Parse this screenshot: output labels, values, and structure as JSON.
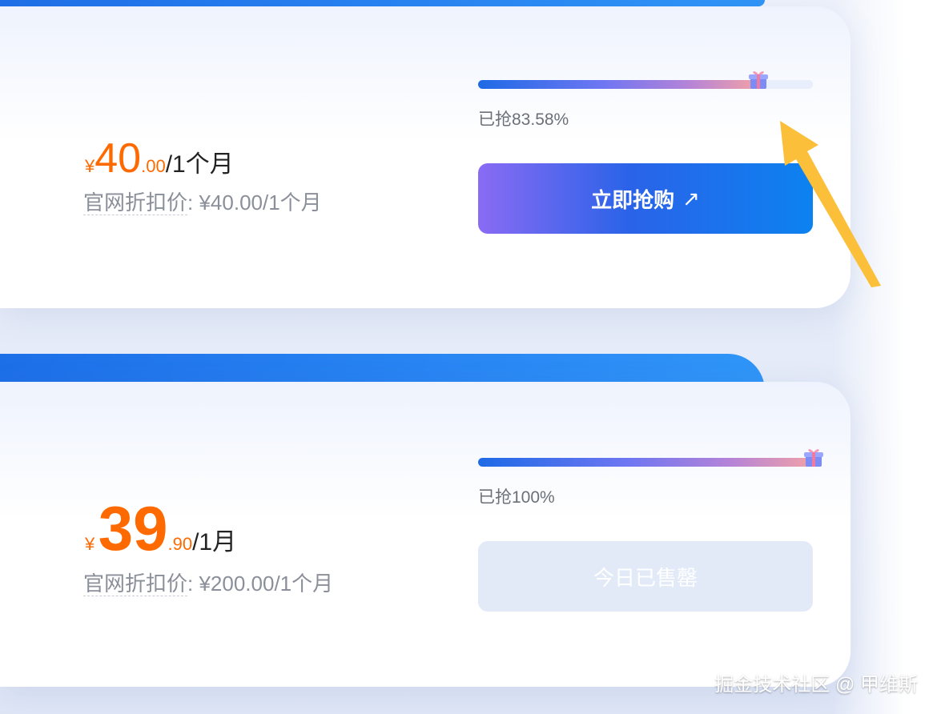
{
  "plans": [
    {
      "price": {
        "currency": "¥",
        "integer": "40",
        "decimal": ".00",
        "period": "/1个月"
      },
      "original": {
        "label": "官网折扣价",
        "value": ": ¥40.00/1个月"
      },
      "progress": {
        "text": "已抢83.58%",
        "fraction": 0.8358
      },
      "button": {
        "label": "立即抢购",
        "arrow": "↗",
        "state": "active"
      }
    },
    {
      "price": {
        "currency": "¥",
        "integer": "39",
        "decimal": ".90",
        "period": "/1月"
      },
      "original": {
        "label": "官网折扣价",
        "value": ": ¥200.00/1个月"
      },
      "progress": {
        "text": "已抢100%",
        "fraction": 1.0
      },
      "button": {
        "label": "今日已售罄",
        "state": "disabled"
      }
    }
  ],
  "watermark": "掘金技术社区 @ 甲维斯",
  "colors": {
    "accent_orange": "#ff6a00",
    "brand_blue": "#1d6fe8",
    "annotation_arrow": "#fbbf3a",
    "sold_out_bg": "#e2eaf8"
  },
  "icons": {
    "gift": "gift-box-icon",
    "arrow": "arrow-up-right-icon",
    "annotation": "yellow-pointer-arrow"
  }
}
